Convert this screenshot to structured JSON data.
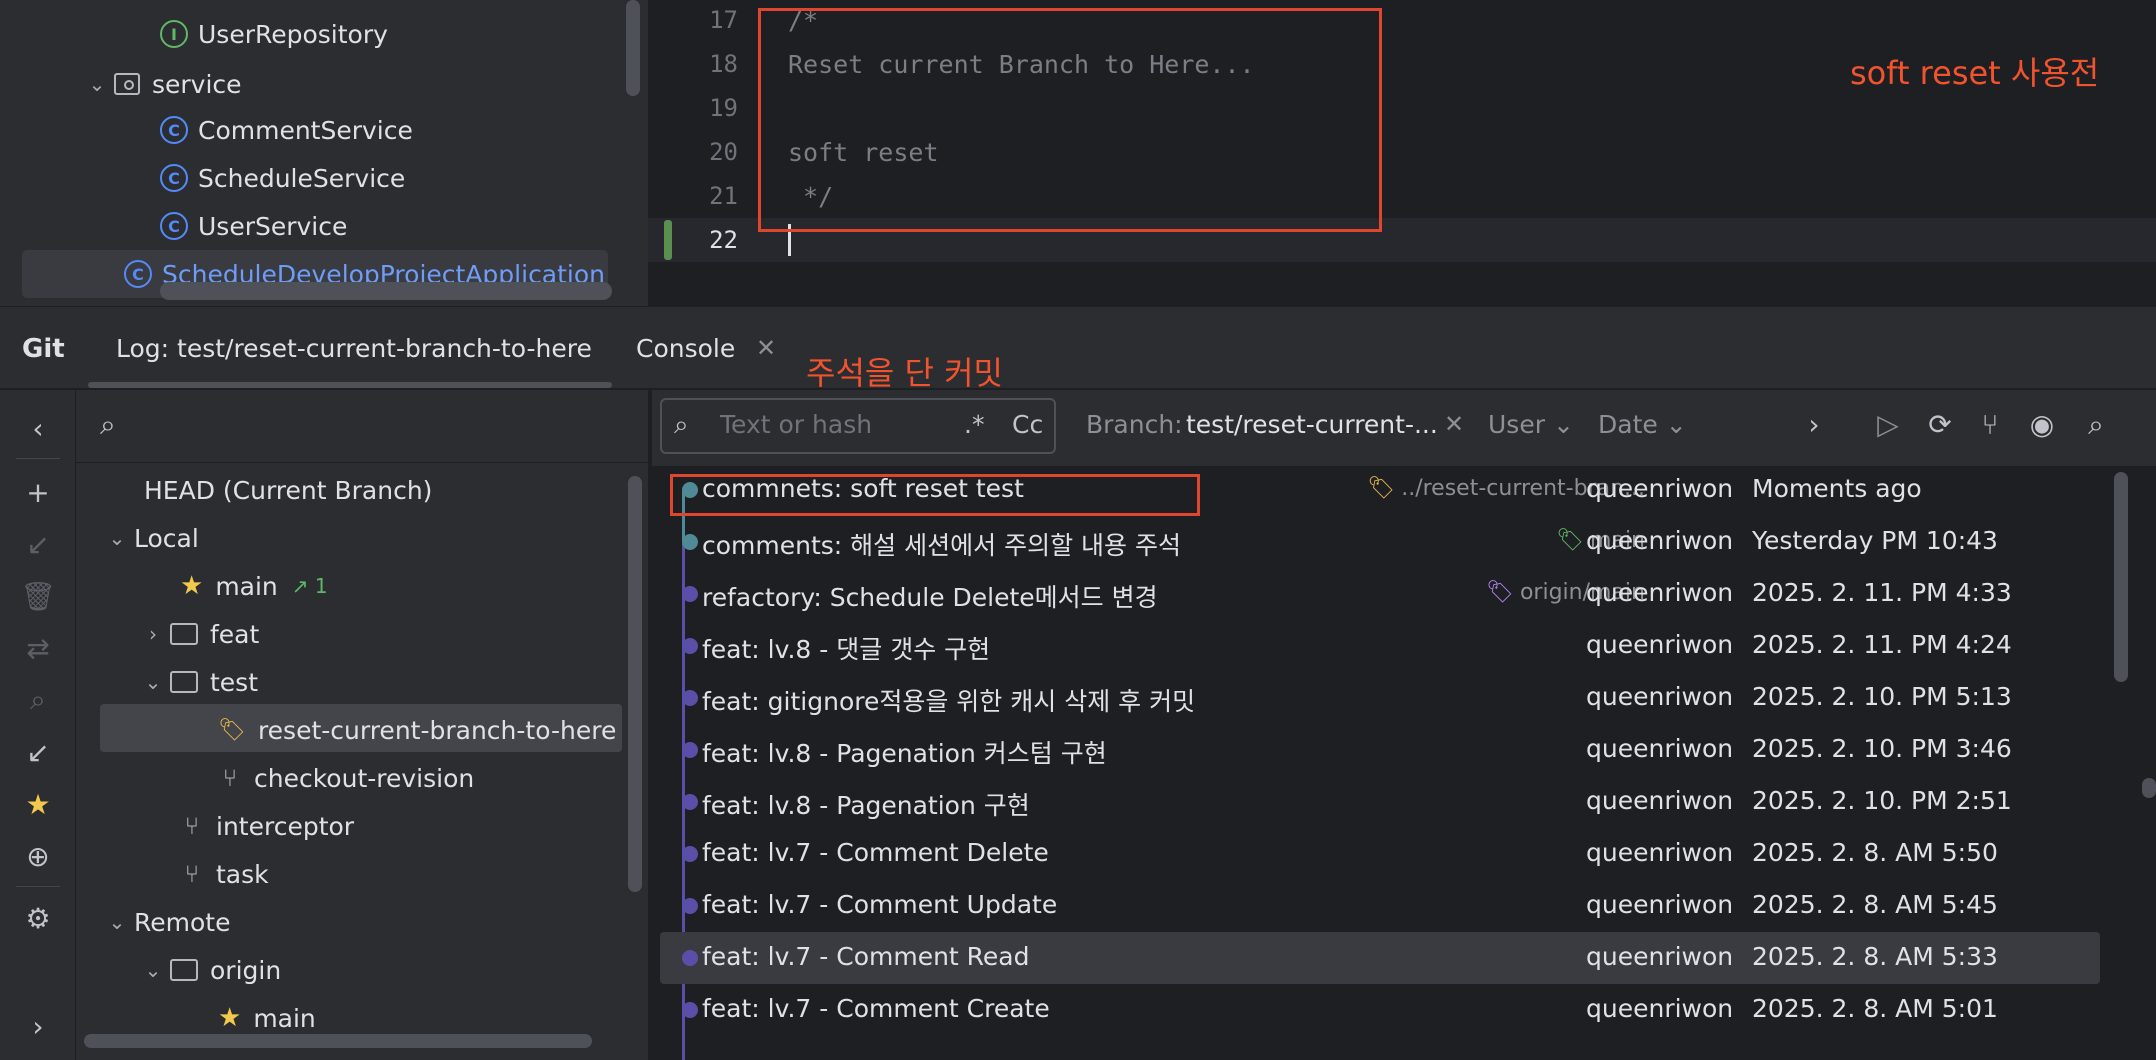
{
  "project_tree": {
    "items": [
      {
        "label": "UserRepository",
        "kind": "interface"
      },
      {
        "label": "service",
        "kind": "package"
      },
      {
        "label": "CommentService",
        "kind": "class"
      },
      {
        "label": "ScheduleService",
        "kind": "class"
      },
      {
        "label": "UserService",
        "kind": "class"
      },
      {
        "label": "ScheduleDevelopProjectApplication",
        "kind": "app"
      }
    ]
  },
  "editor": {
    "lines": [
      {
        "num": "17",
        "text": "/*"
      },
      {
        "num": "18",
        "text": "Reset current Branch to Here..."
      },
      {
        "num": "19",
        "text": ""
      },
      {
        "num": "20",
        "text": "soft reset"
      },
      {
        "num": "21",
        "text": " */"
      },
      {
        "num": "22",
        "text": ""
      }
    ],
    "annotation": "soft reset 사용전"
  },
  "git": {
    "title": "Git",
    "tabs": {
      "log": "Log: test/reset-current-branch-to-here",
      "console": "Console"
    },
    "annotation": "주석을 단 커밋"
  },
  "branches": {
    "head": "HEAD (Current Branch)",
    "local_label": "Local",
    "main": "main",
    "main_ahead": "↗ 1",
    "feat": "feat",
    "test": "test",
    "reset_branch": "reset-current-branch-to-here",
    "checkout": "checkout-revision",
    "interceptor": "interceptor",
    "task": "task",
    "remote_label": "Remote",
    "origin": "origin",
    "origin_main": "main"
  },
  "log_toolbar": {
    "filter_placeholder": "Text or hash",
    "regex": ".*",
    "case": "Cc",
    "branch_label": "Branch:",
    "branch_value": "test/reset-current-...",
    "user": "User",
    "date": "Date"
  },
  "commits": [
    {
      "message": "commnets: soft reset test",
      "ref": "../reset-current-bran...",
      "author": "queenriwon",
      "date": "Moments ago",
      "color": "#4f8a96"
    },
    {
      "message": "comments: 해설 세션에서 주의할 내용 주석",
      "ref": "main",
      "author": "queenriwon",
      "date": "Yesterday PM 10:43",
      "color": "#4f8a96"
    },
    {
      "message": "refactory: Schedule Delete메서드 변경",
      "ref": "origin/main",
      "author": "queenriwon",
      "date": "2025. 2. 11. PM 4:33",
      "color": "#5a4fa8"
    },
    {
      "message": "feat: lv.8 - 댓글 갯수 구현",
      "ref": "",
      "author": "queenriwon",
      "date": "2025. 2. 11. PM 4:24",
      "color": "#5a4fa8"
    },
    {
      "message": "feat: gitignore적용을 위한 캐시 삭제 후 커밋",
      "ref": "",
      "author": "queenriwon",
      "date": "2025. 2. 10. PM 5:13",
      "color": "#5a4fa8"
    },
    {
      "message": "feat: lv.8 - Pagenation 커스텀 구현",
      "ref": "",
      "author": "queenriwon",
      "date": "2025. 2. 10. PM 3:46",
      "color": "#5a4fa8"
    },
    {
      "message": "feat: lv.8 - Pagenation 구현",
      "ref": "",
      "author": "queenriwon",
      "date": "2025. 2. 10. PM 2:51",
      "color": "#5a4fa8"
    },
    {
      "message": "feat: lv.7 - Comment Delete",
      "ref": "",
      "author": "queenriwon",
      "date": "2025. 2. 8. AM 5:50",
      "color": "#5a4fa8"
    },
    {
      "message": "feat: lv.7 - Comment Update",
      "ref": "",
      "author": "queenriwon",
      "date": "2025. 2. 8. AM 5:45",
      "color": "#5a4fa8"
    },
    {
      "message": "feat: lv.7 - Comment Read",
      "ref": "",
      "author": "queenriwon",
      "date": "2025. 2. 8. AM 5:33",
      "color": "#5a4fa8"
    },
    {
      "message": "feat: lv.7 - Comment Create",
      "ref": "",
      "author": "queenriwon",
      "date": "2025. 2. 8. AM 5:01",
      "color": "#5a4fa8"
    }
  ]
}
